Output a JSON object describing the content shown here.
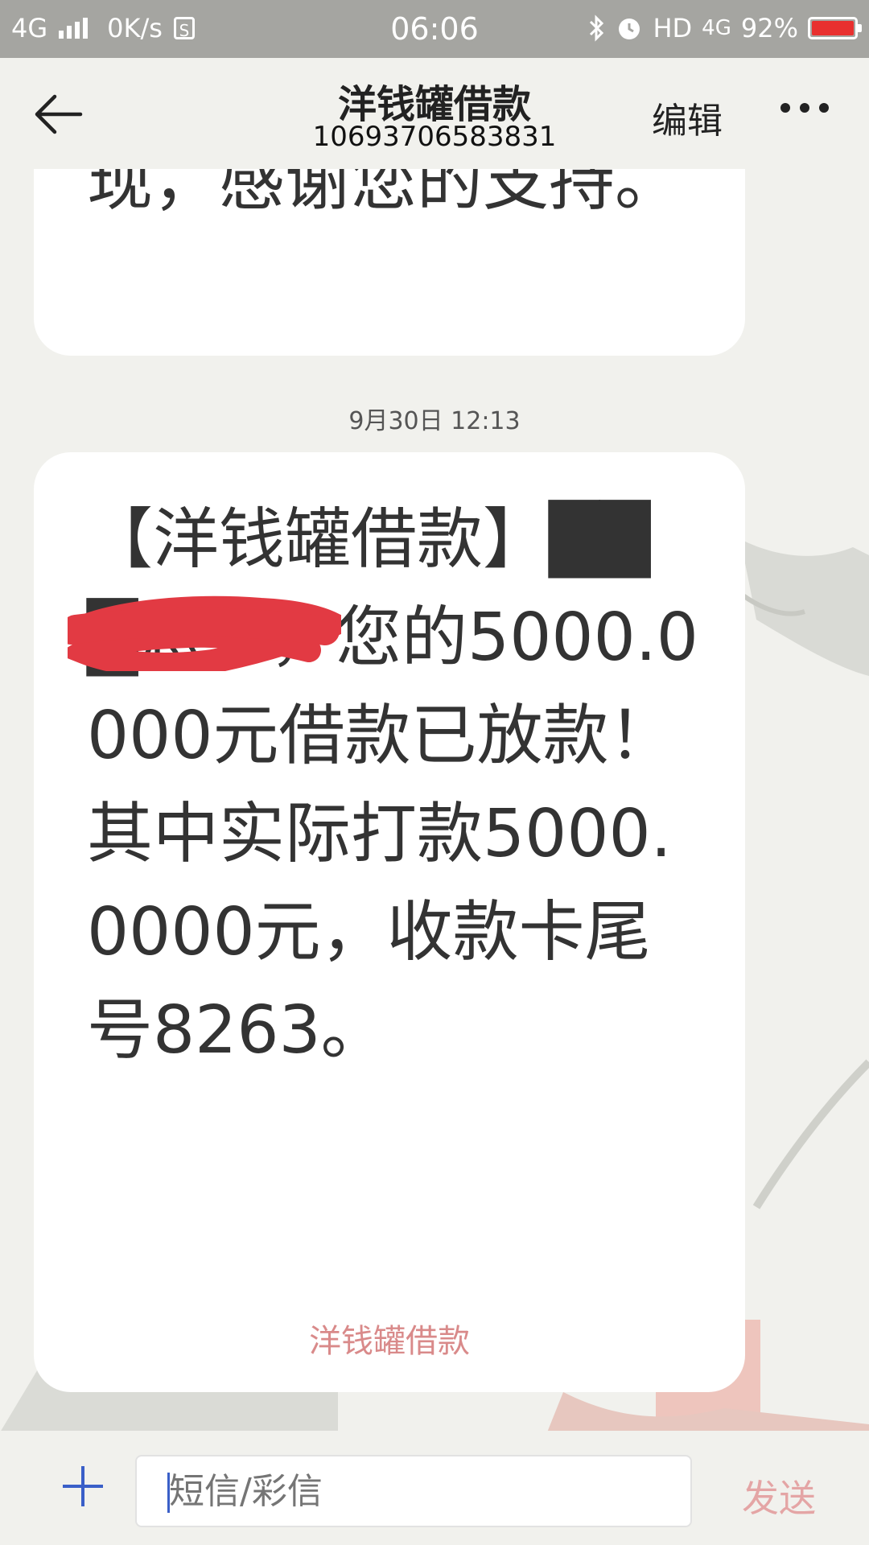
{
  "status_bar": {
    "network": "4G",
    "speed": "0K/s",
    "sim": "S",
    "time": "06:06",
    "hd": "HD",
    "net2": "4G",
    "battery": "92%"
  },
  "header": {
    "title": "洋钱罐借款",
    "subtitle": "10693706583831",
    "edit_label": "编辑"
  },
  "messages": {
    "prev_text": "现，感谢您的支持。",
    "timestamp": "9月30日 12:13",
    "main_text": "【洋钱罐借款】███您好，您的5000.0000元借款已放款！其中实际打款5000.0000元，收款卡尾号8263。",
    "signature": "洋钱罐借款"
  },
  "input_bar": {
    "placeholder": "短信/彩信",
    "send_label": "发送"
  },
  "colors": {
    "status_bar_bg": "#a5a5a1",
    "battery_fill": "#e8302f",
    "accent": "#3a5fc8",
    "send_disabled": "#e4a5a5",
    "redaction": "#e23a43"
  }
}
